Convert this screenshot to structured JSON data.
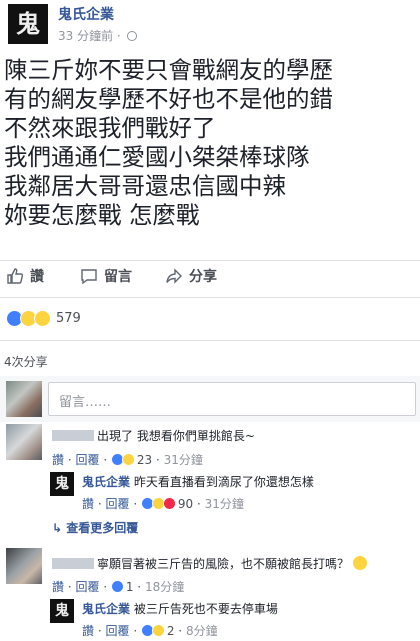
{
  "post": {
    "avatar_glyph": "鬼",
    "page_name": "鬼氏企業",
    "time": "33 分鐘前 ·",
    "lines": [
      "陳三斤妳不要只會戰網友的學歷",
      "有的網友學歷不好也不是他的錯",
      "不然來跟我們戰好了",
      "我們通通仁愛國小桀桀棒球隊",
      "我鄰居大哥哥還忠信國中辣",
      "妳要怎麼戰 怎麼戰"
    ]
  },
  "actions": {
    "like": "讚",
    "comment": "留言",
    "share": "分享"
  },
  "reactions": {
    "count": "579"
  },
  "shares": "4次分享",
  "comment_input": {
    "placeholder": "留言……"
  },
  "comments": [
    {
      "text": "出現了 我想看你們單挑館長~",
      "like": "讚",
      "dot1": "·",
      "reply": "回覆",
      "dot2": "·",
      "reaction_count": "23",
      "time": "31分鐘"
    },
    {
      "author": "鬼氏企業",
      "text": "昨天看直播看到滴尿了你還想怎樣",
      "like": "讚",
      "dot1": "·",
      "reply": "回覆",
      "dot2": "·",
      "reaction_count": "90",
      "time": "31分鐘"
    },
    {
      "more": "↳ 查看更多回覆"
    },
    {
      "text": "寧願冒著被三斤告的風險，也不願被館長打嗎？",
      "like": "讚",
      "dot1": "·",
      "reply": "回覆",
      "dot2": "·",
      "reaction_count": "1",
      "time": "18分鐘"
    },
    {
      "author": "鬼氏企業",
      "text": "被三斤告死也不要去停車場",
      "like": "讚",
      "dot1": "·",
      "reply": "回覆",
      "dot2": "·",
      "reaction_count": "2",
      "time": "8分鐘"
    }
  ],
  "colors": {
    "link": "#365899",
    "meta": "#90949c",
    "like": "#4080ff",
    "emoji": "#fcd43f"
  }
}
